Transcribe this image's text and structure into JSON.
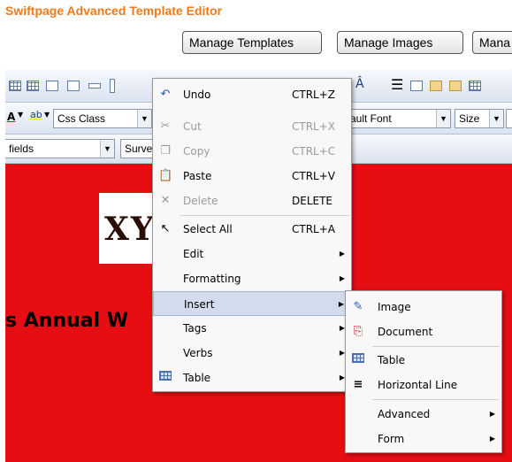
{
  "app_title": "Swiftpage Advanced Template Editor",
  "top_buttons": [
    "Manage Templates",
    "Manage Images",
    "Mana"
  ],
  "toolbar": {
    "css_class": "Css Class",
    "font": "ault Font",
    "size": "Size",
    "fields": "fields",
    "survey": "Surve"
  },
  "canvas": {
    "background": "#e60e13",
    "logo_text": "XY",
    "headline": "s Annual W"
  },
  "context_menu": {
    "items": [
      {
        "label": "Undo",
        "shortcut": "CTRL+Z",
        "icon": "undo-icon"
      },
      {
        "label": "Cut",
        "shortcut": "CTRL+X",
        "icon": "cut-icon",
        "disabled": true
      },
      {
        "label": "Copy",
        "shortcut": "CTRL+C",
        "icon": "copy-icon",
        "disabled": true
      },
      {
        "label": "Paste",
        "shortcut": "CTRL+V",
        "icon": "paste-icon"
      },
      {
        "label": "Delete",
        "shortcut": "DELETE",
        "icon": "delete-icon",
        "disabled": true
      },
      {
        "label": "Select All",
        "shortcut": "CTRL+A",
        "icon": "select-all-icon"
      },
      {
        "label": "Edit"
      },
      {
        "label": "Formatting"
      },
      {
        "label": "Insert"
      },
      {
        "label": "Tags"
      },
      {
        "label": "Verbs"
      },
      {
        "label": "Table",
        "icon": "table-icon"
      }
    ]
  },
  "insert_submenu": {
    "items": [
      {
        "label": "Image",
        "icon": "image-icon"
      },
      {
        "label": "Document",
        "icon": "pdf-document-icon"
      },
      {
        "label": "Table",
        "icon": "table-icon"
      },
      {
        "label": "Horizontal Line",
        "icon": "horizontal-line-icon"
      },
      {
        "label": "Advanced"
      },
      {
        "label": "Form"
      }
    ]
  }
}
